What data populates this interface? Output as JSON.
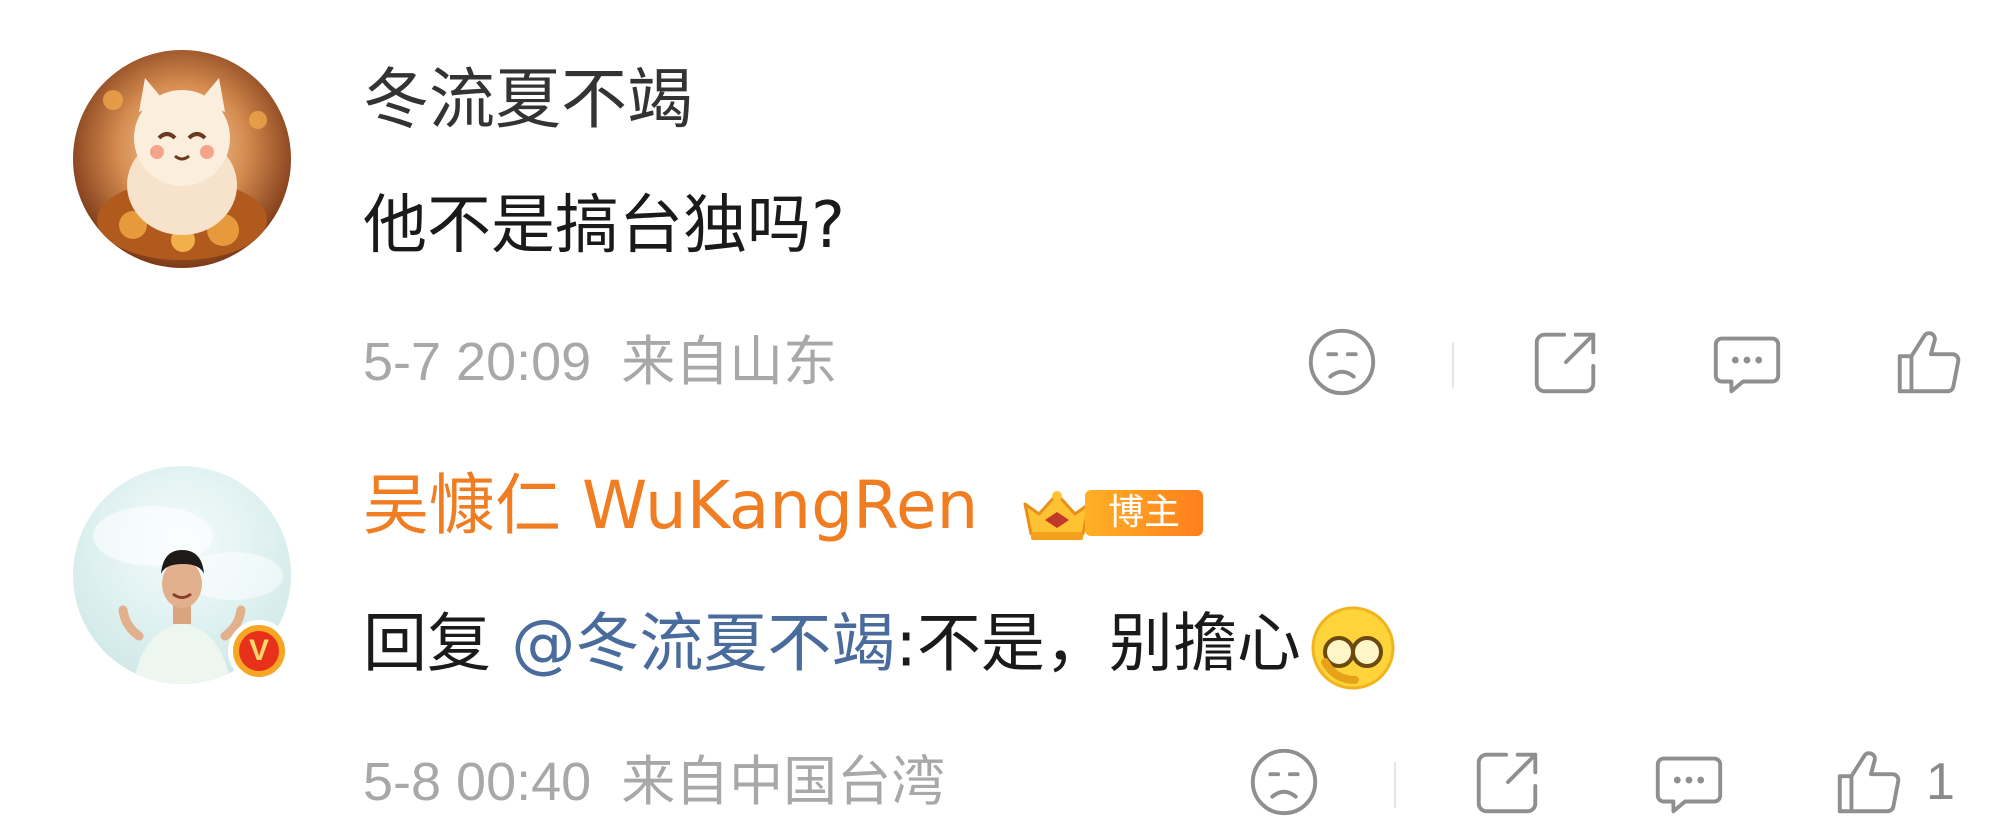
{
  "comments": [
    {
      "username": "冬流夏不竭",
      "content": "他不是搞台独吗?",
      "time": "5-7 20:09",
      "location": "来自山东",
      "like_count": "",
      "avatar": "lucky-cat-avatar"
    },
    {
      "username": "吴慷仁 WuKangRen",
      "badge": "博主",
      "verified": "V",
      "reply_prefix": "回复",
      "mention": "@冬流夏不竭",
      "content": ":不是，别擔心",
      "emoji": "face-with-glasses-emoji",
      "time": "5-8 00:40",
      "location": "来自中国台湾",
      "like_count": "1",
      "avatar": "man-portrait-avatar"
    }
  ],
  "icons": [
    "dislike-face-icon",
    "share-icon",
    "reply-comment-icon",
    "like-thumb-icon"
  ],
  "colors": {
    "username_author": "#f07d22",
    "mention": "#496c9d",
    "meta_gray": "#a8a8a8"
  }
}
